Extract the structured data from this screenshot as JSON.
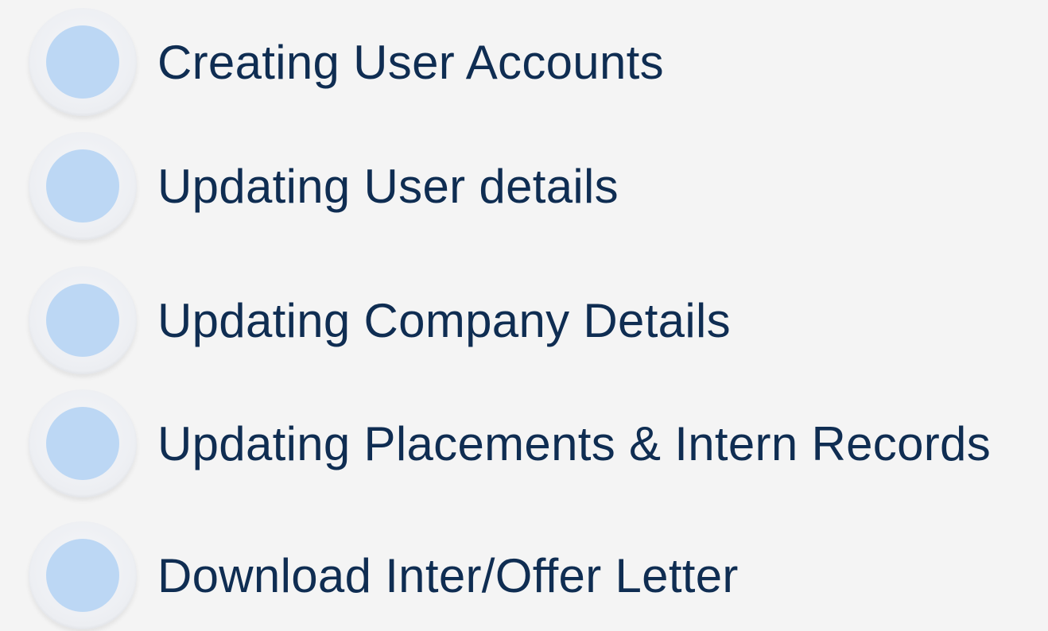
{
  "features": [
    {
      "label": "Creating User Accounts"
    },
    {
      "label": "Updating User details"
    },
    {
      "label": "Updating Company Details"
    },
    {
      "label": "Updating Placements & Intern Records"
    },
    {
      "label": "Download Inter/Offer Letter"
    }
  ],
  "colors": {
    "background": "#f4f4f4",
    "text": "#0f2d52",
    "bullet_dot": "#bcd7f4",
    "bullet_ring": "#eceef2"
  }
}
